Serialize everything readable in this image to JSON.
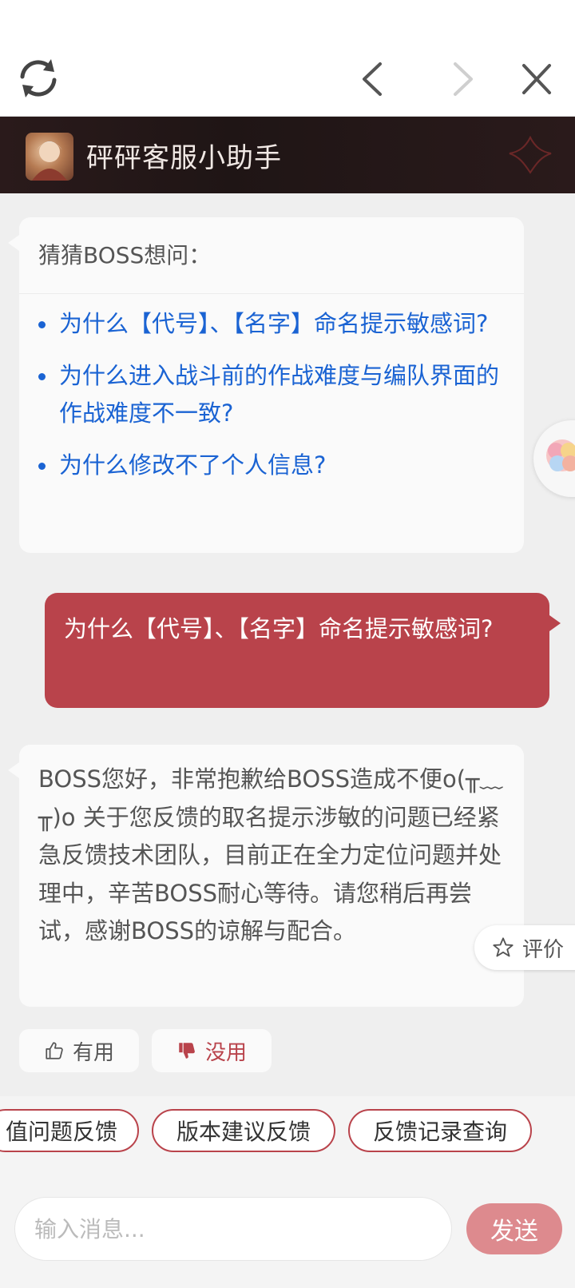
{
  "header": {
    "title": "砰砰客服小助手"
  },
  "suggest": {
    "title": "猜猜BOSS想问：",
    "items": [
      "为什么【代号】、【名字】命名提示敏感词?",
      "为什么进入战斗前的作战难度与编队界面的作战难度不一致?",
      "为什么修改不了个人信息?"
    ]
  },
  "user_message": "为什么【代号】、【名字】命名提示敏感词?",
  "answer": {
    "text": "BOSS您好，非常抱歉给BOSS造成不便o(╥﹏╥)o 关于您反馈的取名提示涉敏的问题已经紧急反馈技术团队，目前正在全力定位问题并处理中，辛苦BOSS耐心等待。请您稍后再尝试，感谢BOSS的谅解与配合。",
    "useful_label": "有用",
    "useless_label": "没用"
  },
  "rate_label": "评价",
  "chips": [
    "值问题反馈",
    "版本建议反馈",
    "反馈记录查询"
  ],
  "input": {
    "placeholder": "输入消息...",
    "value": ""
  },
  "send_label": "发送",
  "colors": {
    "accent": "#b9434b",
    "link": "#1a63d3",
    "send": "#dd8a8e"
  },
  "icons": [
    "refresh-icon",
    "back-arrow-icon",
    "forward-arrow-icon",
    "close-icon",
    "thumbs-up-icon",
    "thumbs-down-icon",
    "star-icon",
    "avatar-image",
    "floating-assistant-icon"
  ]
}
